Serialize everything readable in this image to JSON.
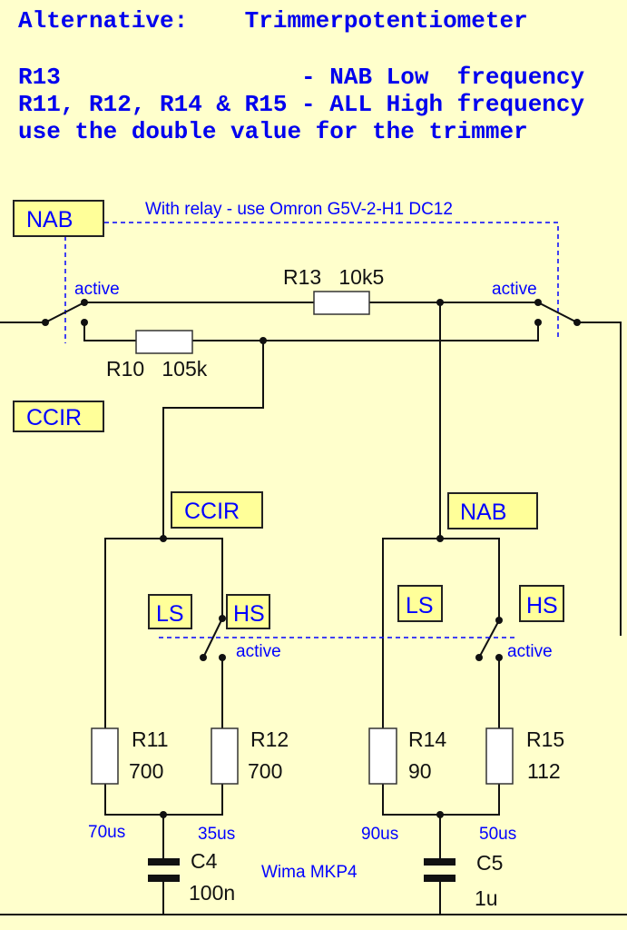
{
  "header": {
    "line1": "Alternative:    Trimmerpotentiometer",
    "line2": "R13                 - NAB Low  frequency",
    "line3": "R11, R12, R14 & R15 - ALL High frequency",
    "line4": "use the double value for the trimmer"
  },
  "relay_note": "With relay - use Omron G5V-2-H1 DC12",
  "labels": {
    "nab_top": "NAB",
    "ccir_left": "CCIR",
    "ccir_mid": "CCIR",
    "nab_mid": "NAB",
    "ls_left": "LS",
    "hs_left": "HS",
    "ls_right": "LS",
    "hs_right": "HS",
    "active_1": "active",
    "active_2": "active",
    "active_3": "active",
    "active_4": "active"
  },
  "components": {
    "r13": "R13   10k5",
    "r10": "R10   105k",
    "r11": {
      "name": "R11",
      "value": "700"
    },
    "r12": {
      "name": "R12",
      "value": "700"
    },
    "r14": {
      "name": "R14",
      "value": "90"
    },
    "r15": {
      "name": "R15",
      "value": "112"
    },
    "c4": {
      "name": "C4",
      "value": "100n"
    },
    "c5": {
      "name": "C5",
      "value": "1u"
    },
    "cap_type": "Wima MKP4"
  },
  "time_constants": {
    "t1": "70us",
    "t2": "35us",
    "t3": "90us",
    "t4": "50us"
  },
  "colors": {
    "background": "#ffffcc",
    "label_box": "#ffff99",
    "text_blue": "#0000ff",
    "wire": "#111111"
  }
}
